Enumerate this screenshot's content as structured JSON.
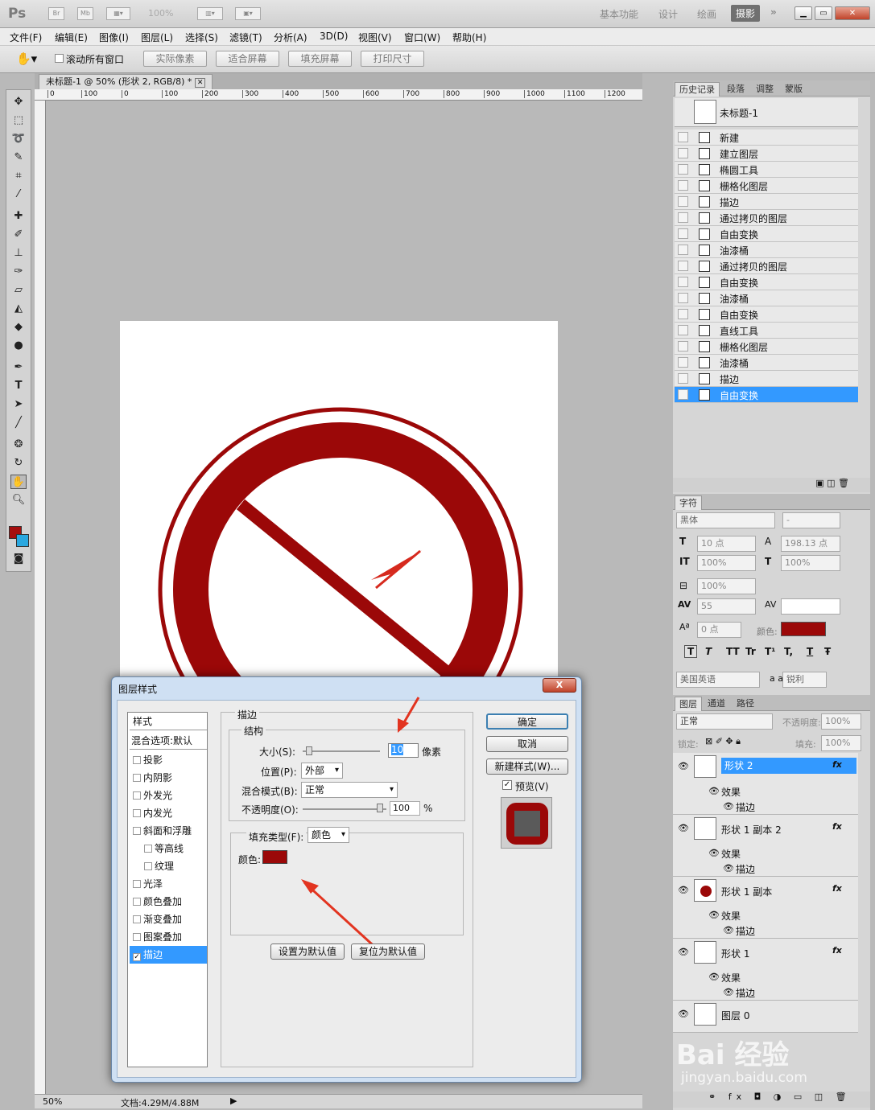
{
  "app": {
    "logo": "Ps",
    "bridge": "Br",
    "minibridge": "Mb",
    "zoom_field": "100%"
  },
  "workspaces": [
    "基本功能",
    "设计",
    "绘画",
    "摄影"
  ],
  "active_workspace": "摄影",
  "menu": [
    "文件(F)",
    "编辑(E)",
    "图像(I)",
    "图层(L)",
    "选择(S)",
    "滤镜(T)",
    "分析(A)",
    "3D(D)",
    "视图(V)",
    "窗口(W)",
    "帮助(H)"
  ],
  "options": {
    "scroll_all": "滚动所有窗口",
    "buttons": [
      "实际像素",
      "适合屏幕",
      "填充屏幕",
      "打印尺寸"
    ]
  },
  "document": {
    "tab_title": "未标题-1 @ 50% (形状 2, RGB/8) *",
    "ruler_marks": [
      "0",
      "100",
      "0",
      "100",
      "200",
      "300",
      "400",
      "500",
      "600",
      "700",
      "800",
      "900",
      "1000",
      "1100",
      "1200"
    ],
    "zoom": "50%",
    "doc_info": "文档:4.29M/4.88M"
  },
  "colors": {
    "foreground": "#a50e0e",
    "background": "#2aa8e0",
    "stroke": "#9b0808",
    "selection": "#3399ff"
  },
  "history": {
    "tabs": [
      "历史记录",
      "段落",
      "调整",
      "蒙版"
    ],
    "snapshot": "未标题-1",
    "items": [
      "新建",
      "建立图层",
      "椭圆工具",
      "栅格化图层",
      "描边",
      "通过拷贝的图层",
      "自由变换",
      "油漆桶",
      "通过拷贝的图层",
      "自由变换",
      "油漆桶",
      "自由变换",
      "直线工具",
      "栅格化图层",
      "油漆桶",
      "描边",
      "自由变换"
    ],
    "selected": "自由变换"
  },
  "character": {
    "tab": "字符",
    "font": "黑体",
    "style": "-",
    "size": "10 点",
    "leading": "198.13 点",
    "vscale": "100%",
    "hscale": "100%",
    "tsume": "100%",
    "kerning": "55",
    "tracking": "",
    "baseline": "0 点",
    "color_label": "颜色:",
    "styles": [
      "T",
      "T",
      "TT",
      "Tr",
      "T¹",
      "T,",
      "T",
      "Ŧ"
    ],
    "language": "美国英语",
    "aa_label": "a a",
    "antialias": "锐利"
  },
  "layers": {
    "tabs": [
      "图层",
      "通道",
      "路径"
    ],
    "blend": "正常",
    "opacity_label": "不透明度:",
    "opacity": "100%",
    "lock_label": "锁定:",
    "fill_label": "填充:",
    "fill": "100%",
    "items": [
      {
        "name": "形状 2",
        "effects": "效果",
        "sub": "描边"
      },
      {
        "name": "形状 1 副本 2",
        "effects": "效果",
        "sub": "描边"
      },
      {
        "name": "形状 1 副本",
        "effects": "效果",
        "sub": "描边"
      },
      {
        "name": "形状 1",
        "effects": "效果",
        "sub": "描边"
      },
      {
        "name": "图层 0"
      }
    ]
  },
  "dialog": {
    "title": "图层样式",
    "close": "X",
    "styles_header": "样式",
    "blend_default": "混合选项:默认",
    "styles": [
      "投影",
      "内阴影",
      "外发光",
      "内发光",
      "斜面和浮雕",
      "等高线",
      "纹理",
      "光泽",
      "颜色叠加",
      "渐变叠加",
      "图案叠加",
      "描边"
    ],
    "stroke_section": "描边",
    "structure": "结构",
    "size_label": "大小(S):",
    "size": "10",
    "size_unit": "像素",
    "position_label": "位置(P):",
    "position": "外部",
    "blend_label": "混合模式(B):",
    "blend": "正常",
    "opacity_label": "不透明度(O):",
    "opacity": "100",
    "opacity_unit": "%",
    "fill_type_label": "填充类型(F):",
    "fill_type": "颜色",
    "color_label": "颜色:",
    "set_default": "设置为默认值",
    "reset_default": "复位为默认值",
    "ok": "确定",
    "cancel": "取消",
    "new_style": "新建样式(W)...",
    "preview": "预览(V)"
  },
  "watermark": {
    "brand": "Bai 经验",
    "url": "jingyan.baidu.com"
  }
}
